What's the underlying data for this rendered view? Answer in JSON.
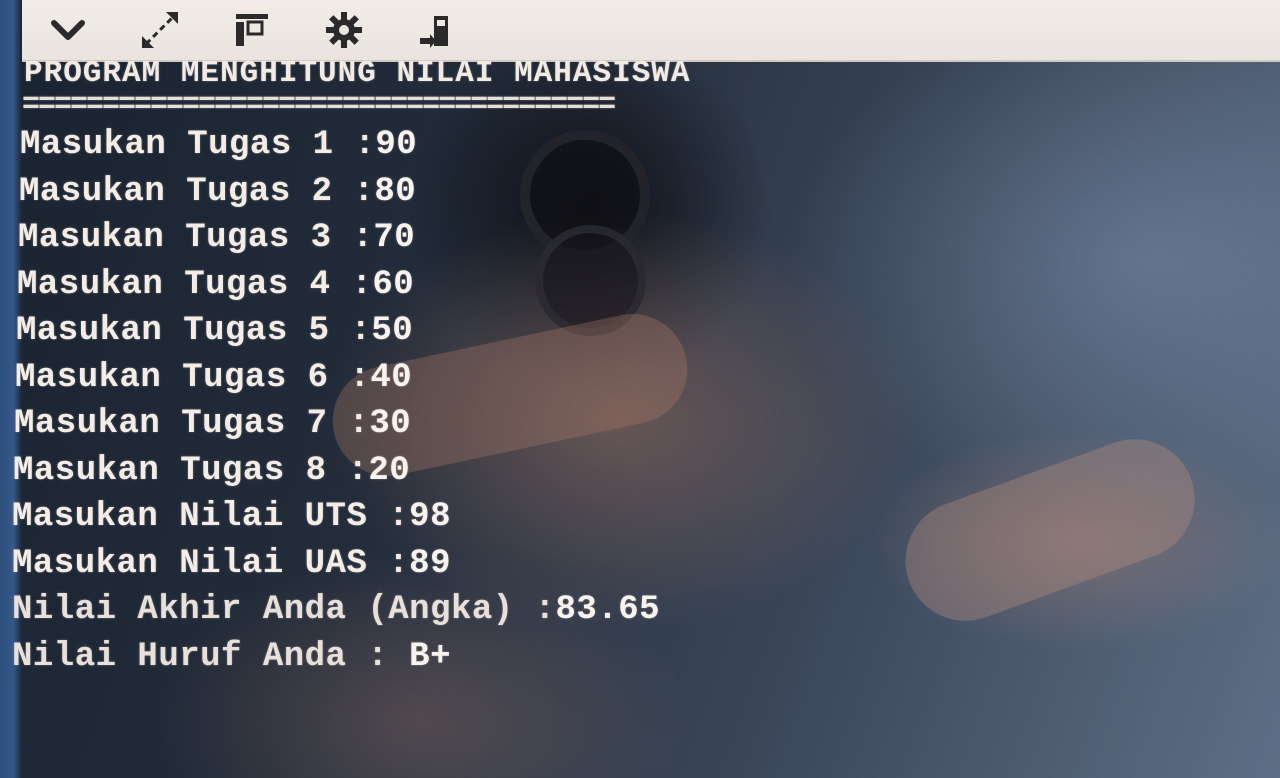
{
  "toolbar": {
    "buttons": [
      {
        "icon": "chevron-down-icon"
      },
      {
        "icon": "expand-arrows-icon"
      },
      {
        "icon": "layout-icon"
      },
      {
        "icon": "gear-icon"
      },
      {
        "icon": "run-icon"
      }
    ]
  },
  "console": {
    "title": "PROGRAM MENGHITUNG NILAI MAHASISWA",
    "separator": "=====================================",
    "inputs": [
      {
        "label": "Masukan Tugas 1 :",
        "value": "90"
      },
      {
        "label": "Masukan Tugas 2 :",
        "value": "80"
      },
      {
        "label": "Masukan Tugas 3 :",
        "value": "70"
      },
      {
        "label": "Masukan Tugas 4 :",
        "value": "60"
      },
      {
        "label": "Masukan Tugas 5 :",
        "value": "50"
      },
      {
        "label": "Masukan Tugas 6 :",
        "value": "40"
      },
      {
        "label": "Masukan Tugas 7 :",
        "value": "30"
      },
      {
        "label": "Masukan Tugas 8 :",
        "value": "20"
      },
      {
        "label": "Masukan Nilai UTS :",
        "value": "98"
      },
      {
        "label": "Masukan Nilai UAS :",
        "value": "89"
      }
    ],
    "results": [
      {
        "label": "Nilai Akhir Anda (Angka) :",
        "value": "83.65"
      },
      {
        "label": "Nilai Huruf Anda : ",
        "value": "B+"
      }
    ]
  },
  "colors": {
    "console_text": "#f3ede6",
    "toolbar_bg": "#ece7e1",
    "background": "#222c3a"
  }
}
